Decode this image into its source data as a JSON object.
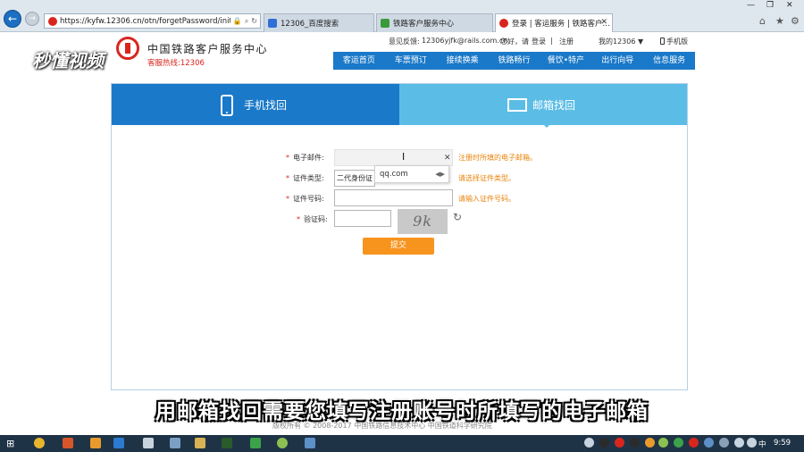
{
  "browser": {
    "address_url": "https://kyfw.12306.cn/otn/forgetPassword/initf",
    "tabs": [
      {
        "title": "12306_百度搜索",
        "active": false
      },
      {
        "title": "铁路客户服务中心",
        "active": false
      },
      {
        "title": "登录 | 客运服务 | 铁路客户...",
        "active": true
      }
    ]
  },
  "site": {
    "title": "中国铁路客户服务中心",
    "hotline": "客服热线:12306",
    "watermark": "秒懂视频",
    "feedback_label": "意见反馈:",
    "feedback_email": "12306yjfk@rails.com.cn",
    "greeting": "您好，请",
    "login_link": "登录",
    "divider": "|",
    "register_link": "注册",
    "my12306": "我的12306",
    "mobile": "手机版"
  },
  "nav": {
    "items": [
      "客运首页",
      "车票预订",
      "接续换乘",
      "铁路畅行",
      "餐饮•特产",
      "出行向导",
      "信息服务"
    ]
  },
  "recover": {
    "tab_phone": "手机找回",
    "tab_email": "邮箱找回",
    "fields": {
      "email_label": "电子邮件:",
      "email_hint": "注册时所填的电子邮箱。",
      "id_type_label": "证件类型:",
      "id_type_value": "二代身份证",
      "id_type_hint": "请选择证件类型。",
      "id_number_label": "证件号码:",
      "id_number_hint": "请输入证件号码。",
      "captcha_label": "验证码:",
      "captcha_text": "9k"
    },
    "suggestion": "qq.com",
    "submit": "提交",
    "required_mark": "*"
  },
  "footer": {
    "copyright": "版权所有 © 2008-2017 中国铁路信息技术中心 中国铁道科学研究院"
  },
  "subtitle": "用邮箱找回需要您填写注册账号时所填写的电子邮箱",
  "taskbar": {
    "ime": "中",
    "clock": "9:59"
  },
  "colors": {
    "nav_blue": "#1a79c9",
    "tab_light_blue": "#5bbde6",
    "accent_red": "#d8261f",
    "hint_orange": "#e8850c",
    "submit_orange": "#f7941d"
  }
}
